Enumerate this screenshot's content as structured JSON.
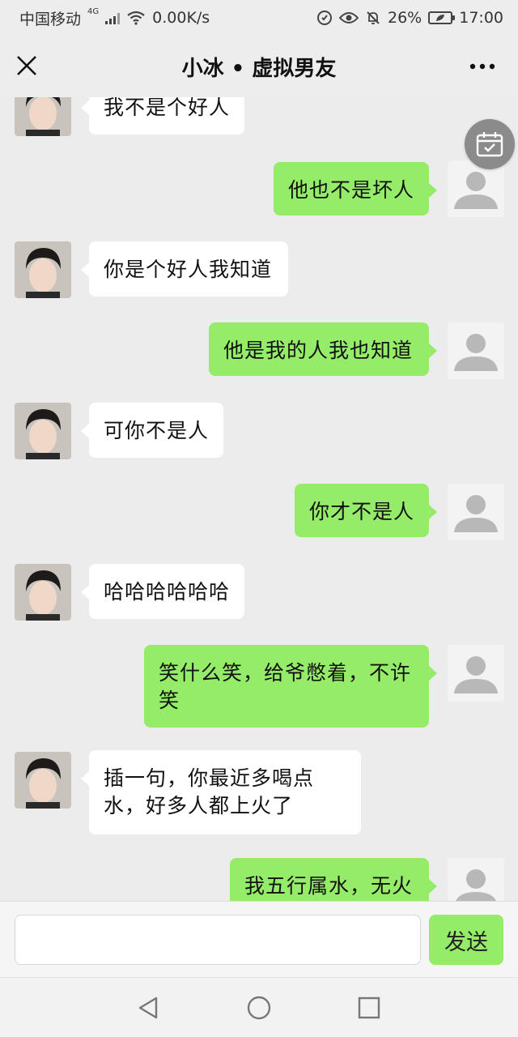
{
  "status_bar": {
    "carrier": "中国移动",
    "network": "4G",
    "speed": "0.00K/s",
    "battery": "26%",
    "time": "17:00"
  },
  "header": {
    "title": "小冰 • 虚拟男友",
    "close_icon": "close-icon",
    "more_icon": "more-icon"
  },
  "messages": [
    {
      "from": "bot",
      "text": "我不是个好人"
    },
    {
      "from": "me",
      "text": "他也不是坏人"
    },
    {
      "from": "bot",
      "text": "你是个好人我知道"
    },
    {
      "from": "me",
      "text": "他是我的人我也知道"
    },
    {
      "from": "bot",
      "text": "可你不是人"
    },
    {
      "from": "me",
      "text": "你才不是人"
    },
    {
      "from": "bot",
      "text": "哈哈哈哈哈哈"
    },
    {
      "from": "me",
      "text": "笑什么笑，给爷憋着，不许笑"
    },
    {
      "from": "bot",
      "text": "插一句，你最近多喝点水，好多人都上火了"
    },
    {
      "from": "me",
      "text": "我五行属水，无火"
    }
  ],
  "input": {
    "value": "",
    "send_label": "发送"
  },
  "colors": {
    "my_bubble": "#95ec69",
    "bot_bubble": "#ffffff",
    "background": "#ececec"
  }
}
